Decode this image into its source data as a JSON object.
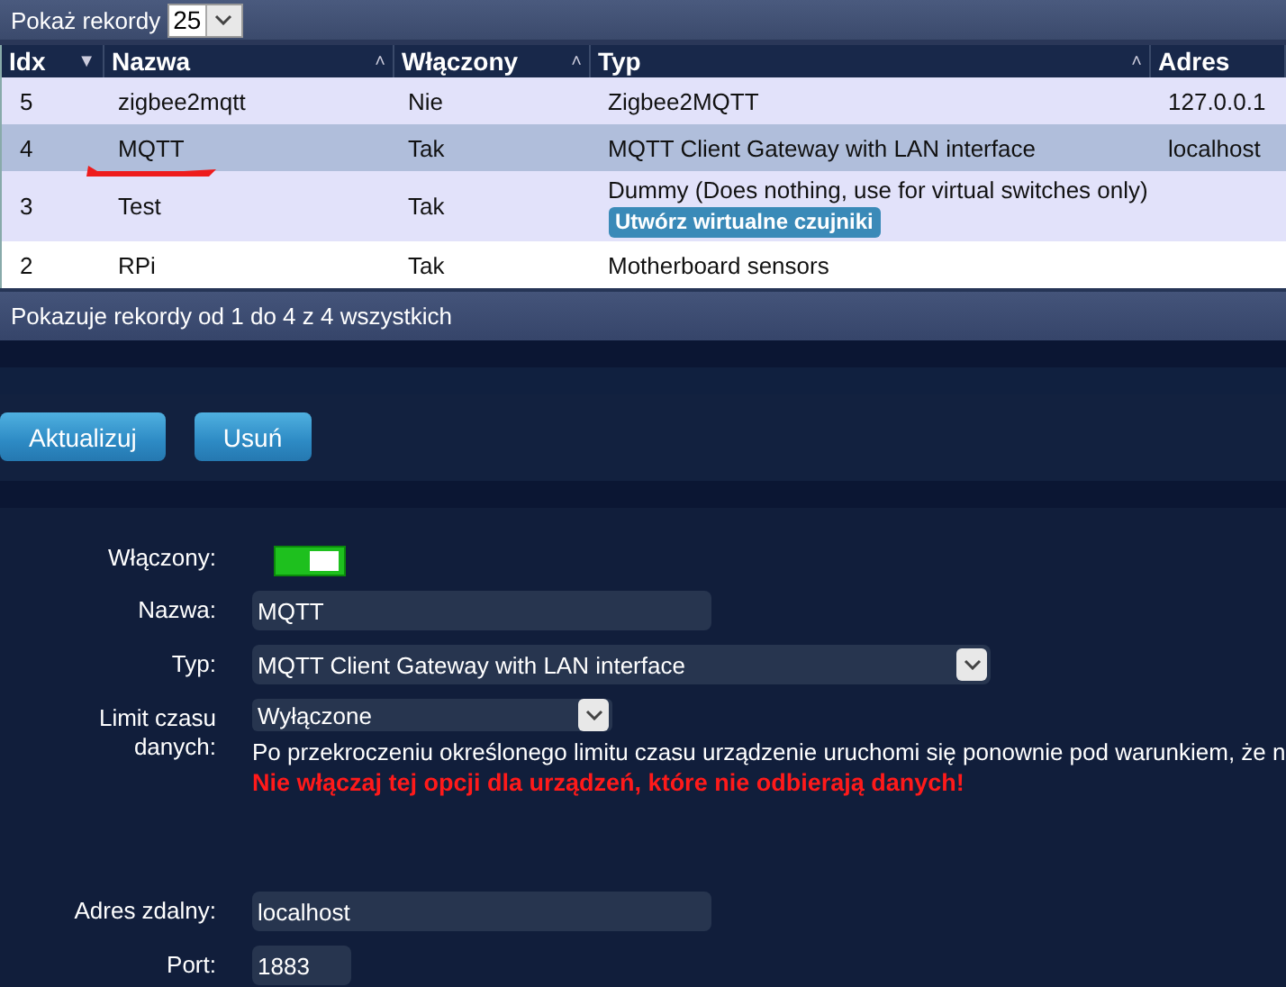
{
  "records_bar": {
    "label": "Pokaż rekordy",
    "page_size": "25"
  },
  "table": {
    "columns": [
      {
        "label": "Idx",
        "sort_icon": "▼"
      },
      {
        "label": "Nazwa",
        "sort_icon": "˄"
      },
      {
        "label": "Włączony",
        "sort_icon": "˄"
      },
      {
        "label": "Typ",
        "sort_icon": "˄"
      },
      {
        "label": "Adres"
      }
    ],
    "rows": [
      {
        "idx": "5",
        "name": "zigbee2mqtt",
        "enabled": "Nie",
        "type": "Zigbee2MQTT",
        "address": "127.0.0.1",
        "selected": false,
        "marked": false
      },
      {
        "idx": "4",
        "name": "MQTT",
        "enabled": "Tak",
        "type": "MQTT Client Gateway with LAN interface",
        "address": "localhost",
        "selected": true,
        "marked": true
      },
      {
        "idx": "3",
        "name": "Test",
        "enabled": "Tak",
        "type": "Dummy (Does nothing, use for virtual switches only)",
        "action": "Utwórz wirtualne czujniki",
        "selected": false,
        "marked": false
      },
      {
        "idx": "2",
        "name": "RPi",
        "enabled": "Tak",
        "type": "Motherboard sensors",
        "selected": false,
        "marked": false
      }
    ],
    "footer": "Pokazuje rekordy od 1 do 4 z 4 wszystkich"
  },
  "buttons": [
    "Aktualizuj",
    "Usuń"
  ],
  "form": [
    {
      "kind": "toggle",
      "label": "Włączony:",
      "on": true
    },
    {
      "kind": "text",
      "label": "Nazwa:",
      "value": "MQTT"
    },
    {
      "kind": "select",
      "label": "Typ:",
      "value": "MQTT Client Gateway with LAN interface"
    },
    {
      "kind": "timeout",
      "label": "Limit czasu danych:",
      "value": "Wyłączone",
      "note": "Po przekroczeniu określonego limitu czasu urządzenie uruchomi się ponownie pod warunkiem, że n",
      "warning": "Nie włączaj tej opcji dla urządzeń, które nie odbierają danych!"
    },
    {
      "kind": "text",
      "label": "Adres zdalny:",
      "value": "localhost"
    },
    {
      "kind": "text",
      "label": "Port:",
      "value": "1883"
    }
  ]
}
